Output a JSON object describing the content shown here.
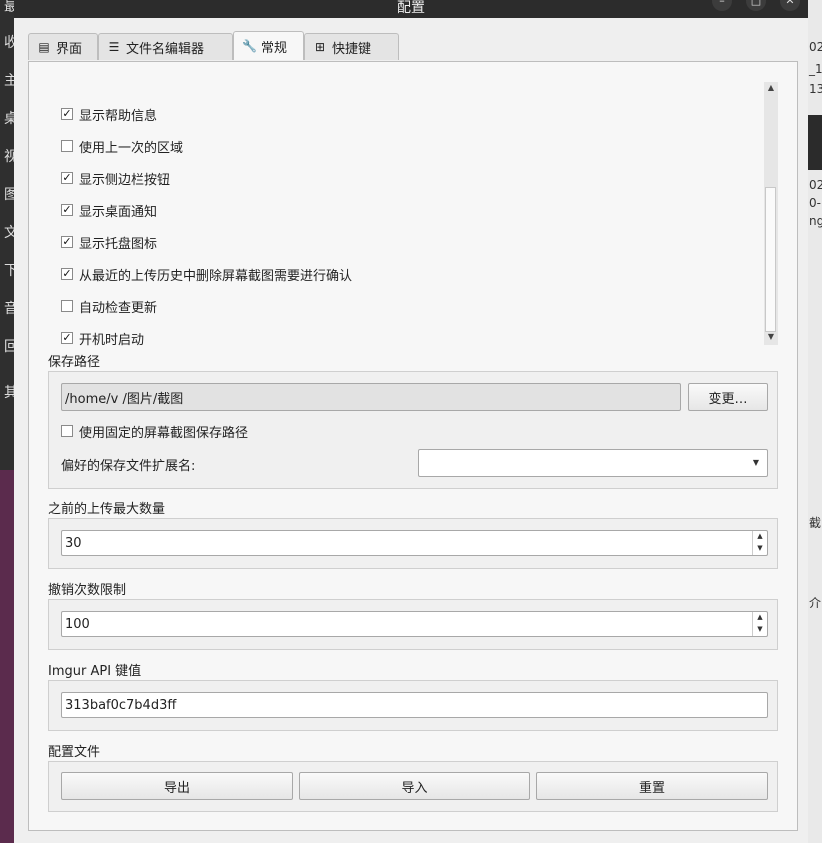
{
  "window": {
    "title": "配置"
  },
  "tabs": [
    {
      "icon": "grid-icon",
      "glyph": "▤",
      "label": "界面"
    },
    {
      "icon": "list-icon",
      "glyph": "☰",
      "label": "文件名编辑器"
    },
    {
      "icon": "wrench-icon",
      "glyph": "🔧",
      "label": "常规"
    },
    {
      "icon": "shortcuts-icon",
      "glyph": "⊞",
      "label": "快捷键"
    }
  ],
  "general": {
    "options": [
      {
        "label": "显示帮助信息",
        "checked": true
      },
      {
        "label": "使用上一次的区域",
        "checked": false
      },
      {
        "label": "显示侧边栏按钮",
        "checked": true
      },
      {
        "label": "显示桌面通知",
        "checked": true
      },
      {
        "label": "显示托盘图标",
        "checked": true
      },
      {
        "label": "从最近的上传历史中删除屏幕截图需要进行确认",
        "checked": true
      },
      {
        "label": "自动检查更新",
        "checked": false
      },
      {
        "label": "开机时启动",
        "checked": true
      }
    ]
  },
  "save_path": {
    "section": "保存路径",
    "path": "/home/v   /图片/截图",
    "change_button": "变更…",
    "fixed_path_label": "使用固定的屏幕截图保存路径",
    "fixed_path_checked": false,
    "extension_label": "偏好的保存文件扩展名:",
    "extension_value": ""
  },
  "upload_history": {
    "section": "之前的上传最大数量",
    "value": "30"
  },
  "undo_limit": {
    "section": "撤销次数限制",
    "value": "100"
  },
  "imgur": {
    "section": "Imgur API 键值",
    "value": "313baf0c7b4d3ff"
  },
  "config_file": {
    "section": "配置文件",
    "export_button": "导出",
    "import_button": "导入",
    "reset_button": "重置"
  },
  "background": {
    "left_chars": [
      "最",
      "收",
      "主",
      "桌",
      "视",
      "图",
      "文",
      "下",
      "音",
      "回",
      "其"
    ],
    "right_chars": [
      "02",
      "_1",
      "13",
      "02",
      "0-",
      "ng",
      "截",
      "介"
    ]
  }
}
